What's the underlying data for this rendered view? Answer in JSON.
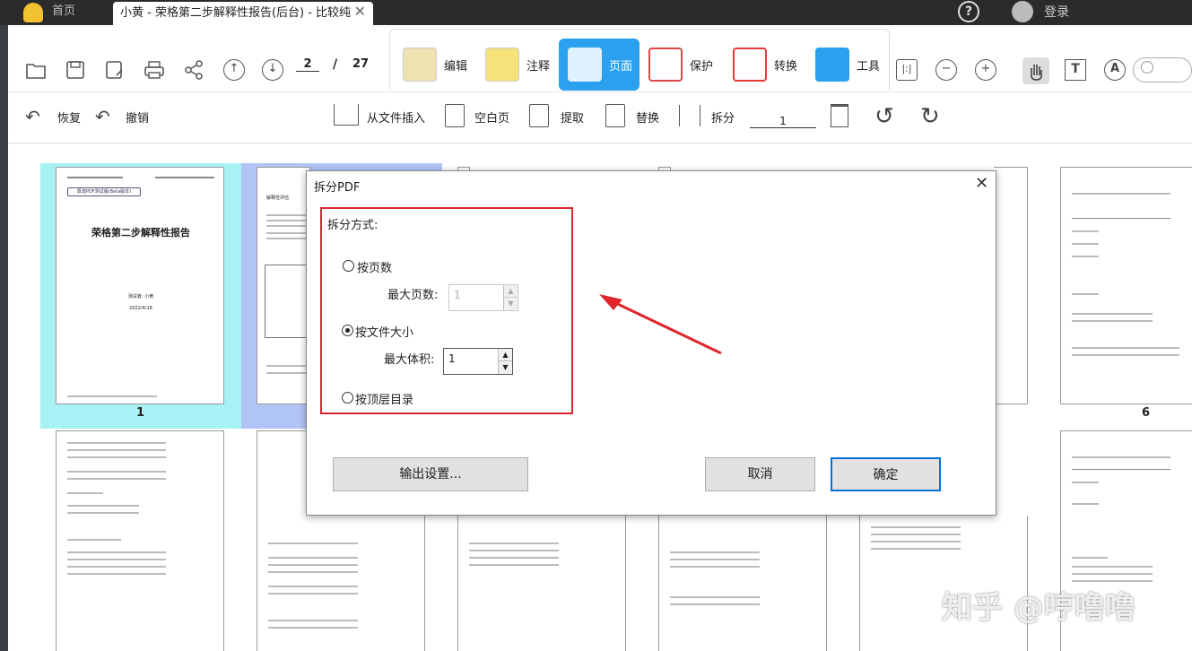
{
  "titlebar": {
    "home_tab": "首页",
    "doc_tab": "小黄 - 荣格第二步解释性报告(后台) - 比较纯粹...",
    "close_glyph": "✕",
    "help_glyph": "?",
    "login": "登录"
  },
  "toolbar": {
    "page_current": "2",
    "page_sep": "/",
    "page_total": "27",
    "ribbon": [
      {
        "label": "编辑",
        "icon": "edit-icon",
        "color": "#f0e2b0"
      },
      {
        "label": "注释",
        "icon": "annotate-icon",
        "color": "#f5e27a"
      },
      {
        "label": "页面",
        "icon": "page-icon",
        "color": "#ffffff"
      },
      {
        "label": "保护",
        "icon": "protect-icon",
        "color": "#e04545"
      },
      {
        "label": "转换",
        "icon": "convert-icon",
        "color": "#e33a3a"
      },
      {
        "label": "工具",
        "icon": "tools-icon",
        "color": "#2aa0ee"
      }
    ],
    "accent": "#2aa0ee"
  },
  "toolbar2": {
    "redo_label": "恢复",
    "undo_label": "撤销",
    "insert_file": "从文件插入",
    "blank_page": "空白页",
    "extract": "提取",
    "replace": "替换",
    "split": "拆分",
    "split_page_value": "1"
  },
  "pages": {
    "cover_title": "荣格第二步解释性报告",
    "cover_badge": "靠谱PDF测试版(Beta版本)",
    "cover_tester": "测试者: 小黄",
    "cover_date": "2022/4/18",
    "page2_heading": "解释性评估",
    "page1_number": "1",
    "page6_number": "6"
  },
  "dialog": {
    "title": "拆分PDF",
    "close": "✕",
    "method_label": "拆分方式:",
    "opt_pages": "按页数",
    "max_pages_label": "最大页数:",
    "max_pages_value": "1",
    "opt_size": "按文件大小",
    "max_size_label": "最大体积:",
    "max_size_value": "1",
    "opt_toc": "按顶层目录",
    "output_btn": "输出设置...",
    "cancel_btn": "取消",
    "ok_btn": "确定",
    "highlight_color": "#d9252f"
  },
  "watermark": "知乎 @哼噜噜"
}
